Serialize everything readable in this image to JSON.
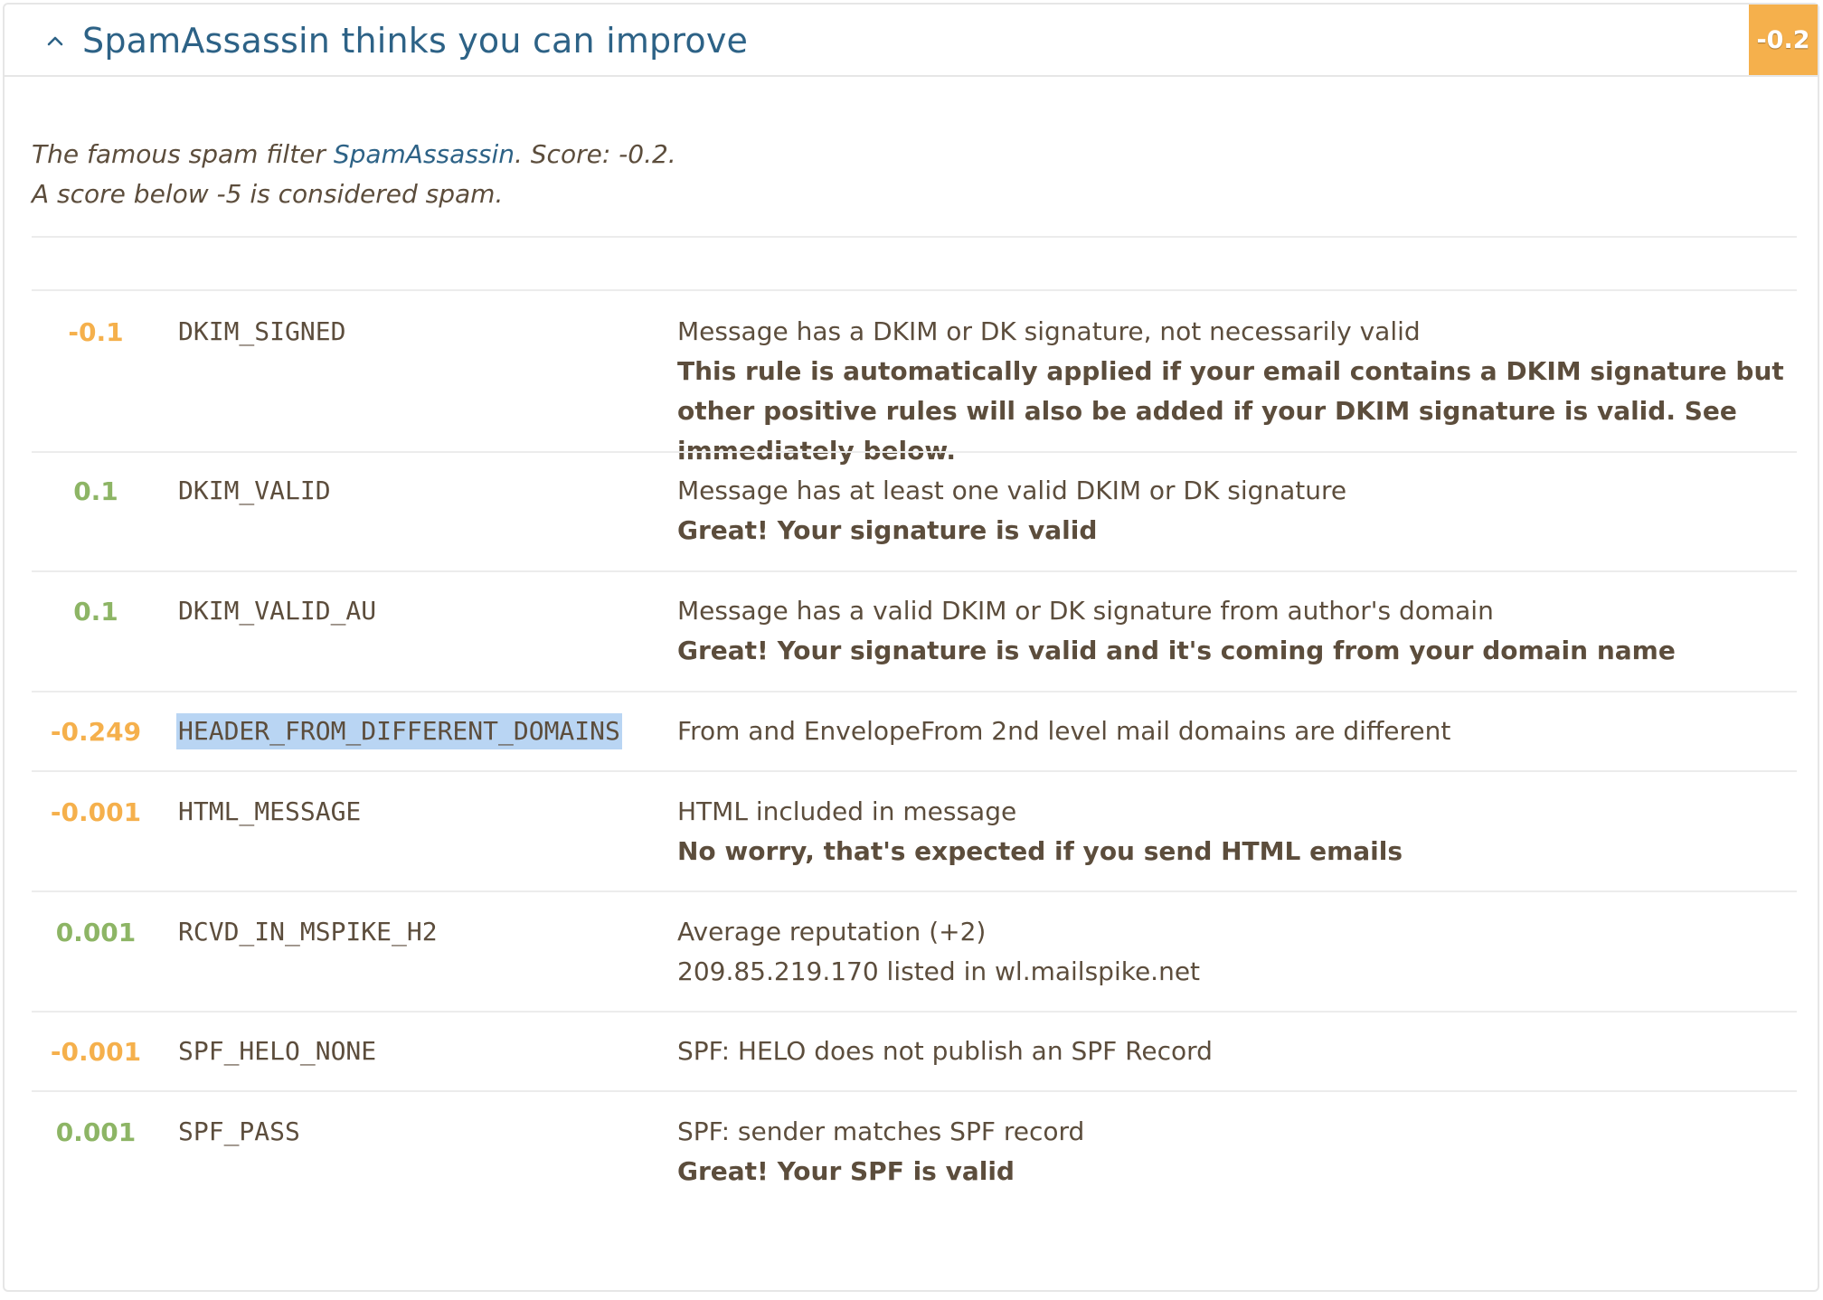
{
  "header": {
    "title": "SpamAssassin thinks you can improve",
    "score": "-0.2"
  },
  "intro": {
    "line1_prefix": "The famous spam filter ",
    "line1_link": "SpamAssassin",
    "line1_suffix": ". Score: -0.2.",
    "line2": "A score below -5 is considered spam."
  },
  "colors": {
    "negative": "#f5b04c",
    "positive": "#8db565",
    "link": "#2d6286",
    "highlight": "#b9d5f3"
  },
  "rules": [
    {
      "score": "-0.1",
      "name": "DKIM_SIGNED",
      "description": "Message has a DKIM or DK signature, not necessarily valid",
      "advice": "This rule is automatically applied if your email contains a DKIM signature but other positive rules will also be added if your DKIM signature is valid. See immediately below."
    },
    {
      "score": "0.1",
      "name": "DKIM_VALID",
      "description": "Message has at least one valid DKIM or DK signature",
      "advice": "Great! Your signature is valid"
    },
    {
      "score": "0.1",
      "name": "DKIM_VALID_AU",
      "description": "Message has a valid DKIM or DK signature from author's domain",
      "advice": "Great! Your signature is valid and it's coming from your domain name"
    },
    {
      "score": "-0.249",
      "name": "HEADER_FROM_DIFFERENT_DOMAINS",
      "description": "From and EnvelopeFrom 2nd level mail domains are different",
      "advice": ""
    },
    {
      "score": "-0.001",
      "name": "HTML_MESSAGE",
      "description": "HTML included in message",
      "advice": "No worry, that's expected if you send HTML emails"
    },
    {
      "score": "0.001",
      "name": "RCVD_IN_MSPIKE_H2",
      "description": "Average reputation (+2)",
      "detail": "209.85.219.170 listed in wl.mailspike.net"
    },
    {
      "score": "-0.001",
      "name": "SPF_HELO_NONE",
      "description": "SPF: HELO does not publish an SPF Record",
      "advice": ""
    },
    {
      "score": "0.001",
      "name": "SPF_PASS",
      "description": "SPF: sender matches SPF record",
      "advice": "Great! Your SPF is valid"
    }
  ]
}
